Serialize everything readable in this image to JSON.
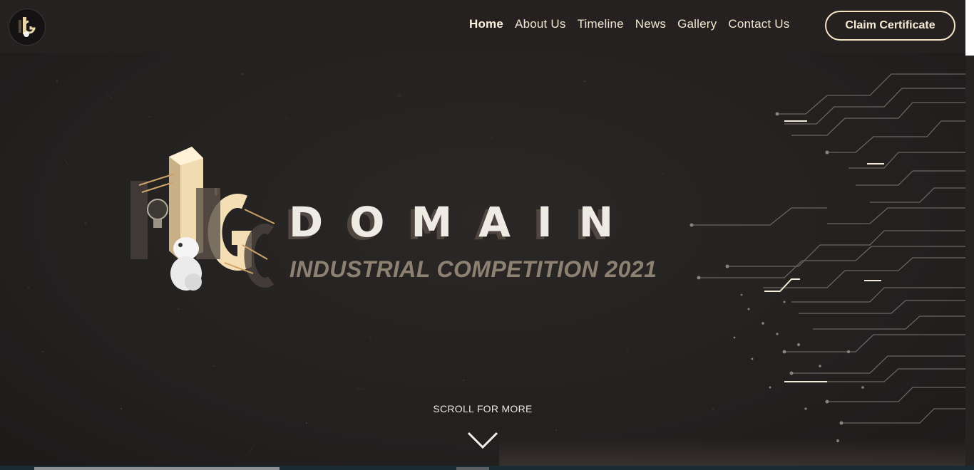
{
  "header": {
    "logo_icon": "iic-logo-icon",
    "nav": [
      {
        "label": "Home",
        "active": true
      },
      {
        "label": "About Us",
        "active": false
      },
      {
        "label": "Timeline",
        "active": false
      },
      {
        "label": "News",
        "active": false
      },
      {
        "label": "Gallery",
        "active": false
      },
      {
        "label": "Contact Us",
        "active": false
      }
    ],
    "cta_label": "Claim Certificate"
  },
  "hero": {
    "emblem_icon": "iic-3d-emblem-icon",
    "title": "DOMAIN",
    "subtitle": "INDUSTRIAL COMPETITION 2021",
    "scroll_label": "SCROLL FOR MORE",
    "scroll_icon": "chevron-down-icon"
  },
  "colors": {
    "background": "#262323",
    "accent_cream": "#f4e6c3",
    "subtitle": "#8d8172",
    "title": "#eeeae4"
  }
}
